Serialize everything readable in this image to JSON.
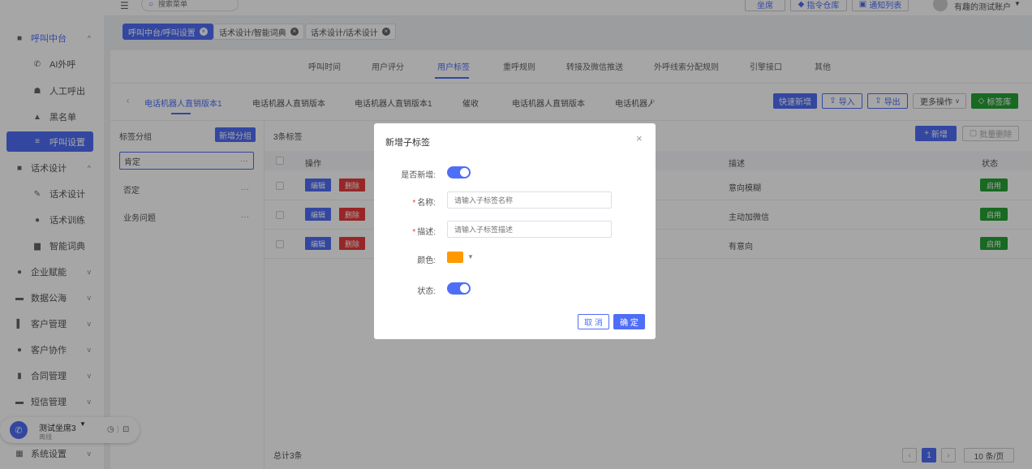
{
  "topbar": {
    "search_placeholder": "搜索菜单",
    "seat_btn": "坐席",
    "command_btn": "指令仓库",
    "notice_btn": "通知列表",
    "account": "有趣的测试账户"
  },
  "sidebar": {
    "items": [
      {
        "label": "呼叫中台",
        "type": "group",
        "icon": "monitor-icon",
        "expanded": true
      },
      {
        "label": "AI外呼",
        "type": "sub",
        "icon": "phone-icon"
      },
      {
        "label": "人工呼出",
        "type": "sub",
        "icon": "users-icon"
      },
      {
        "label": "黑名单",
        "type": "sub",
        "icon": "warning-icon"
      },
      {
        "label": "呼叫设置",
        "type": "sub",
        "icon": "sliders-icon",
        "active": true
      },
      {
        "label": "话术设计",
        "type": "group",
        "icon": "book-icon",
        "expanded": true
      },
      {
        "label": "话术设计",
        "type": "sub",
        "icon": "pen-icon"
      },
      {
        "label": "话术训练",
        "type": "sub",
        "icon": "chat-icon"
      },
      {
        "label": "智能词典",
        "type": "sub",
        "icon": "dictionary-icon"
      },
      {
        "label": "企业赋能",
        "type": "group",
        "icon": "bulb-icon"
      },
      {
        "label": "数据公海",
        "type": "group",
        "icon": "database-icon"
      },
      {
        "label": "客户管理",
        "type": "group",
        "icon": "customer-icon"
      },
      {
        "label": "客户协作",
        "type": "group",
        "icon": "cooperation-icon"
      },
      {
        "label": "合同管理",
        "type": "group",
        "icon": "contract-icon"
      },
      {
        "label": "短信管理",
        "type": "group",
        "icon": "sms-icon"
      },
      {
        "label": "系统设置",
        "type": "group",
        "icon": "grid-icon"
      }
    ]
  },
  "tags": [
    {
      "label": "呼叫中台/呼叫设置",
      "active": true
    },
    {
      "label": "话术设计/智能词典",
      "active": false
    },
    {
      "label": "话术设计/话术设计",
      "active": false
    }
  ],
  "tabs": [
    "呼叫时间",
    "用户评分",
    "用户标签",
    "重呼规则",
    "转接及微信推送",
    "外呼线索分配规则",
    "引擎接口",
    "其他"
  ],
  "active_tab": "用户标签",
  "subtabs": [
    "电话机器人直销版本1",
    "电话机器人直销版本",
    "电话机器人直销版本1",
    "催收",
    "电话机器人直销版本",
    "电话机器人"
  ],
  "toolbar": {
    "quick_add": "快速新增",
    "import": "导入",
    "export": "导出",
    "more": "更多操作",
    "tag_lib": "标签库"
  },
  "groups": {
    "title": "标签分组",
    "add_btn": "新增分组",
    "items": [
      "肯定",
      "否定",
      "业务问题"
    ]
  },
  "table": {
    "count_label": "3条标签",
    "new_btn": "新增",
    "batch_delete": "批量删除",
    "headers": {
      "op": "操作",
      "desc": "描述",
      "status": "状态"
    },
    "edit": "编辑",
    "delete": "删除",
    "rows": [
      {
        "desc": "意向模糊",
        "status": "启用"
      },
      {
        "desc": "主动加微信",
        "status": "启用"
      },
      {
        "desc": "有意向",
        "status": "启用"
      }
    ],
    "total": "总计3条",
    "page": "1",
    "page_size": "10 条/页"
  },
  "modal": {
    "title": "新增子标签",
    "is_new_label": "是否新增:",
    "name_label": "名称:",
    "name_placeholder": "请输入子标签名称",
    "desc_label": "描述:",
    "desc_placeholder": "请输入子标签描述",
    "color_label": "颜色:",
    "color_value": "#ff9900",
    "status_label": "状态:",
    "cancel": "取 消",
    "confirm": "确 定"
  },
  "phone_widget": {
    "seat_name": "测试坐席3",
    "status": "离线"
  }
}
